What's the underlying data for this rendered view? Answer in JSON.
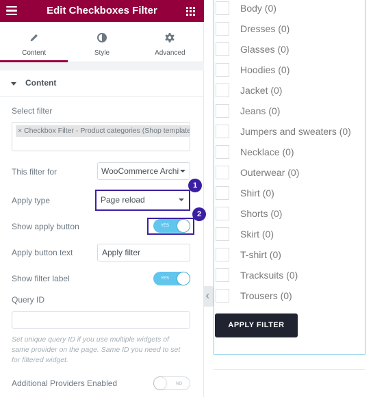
{
  "header": {
    "title": "Edit Checkboxes Filter",
    "menu_icon": "hamburger-icon",
    "grid_icon": "apps-grid-icon",
    "brand_color": "#93003c"
  },
  "tabs": [
    {
      "label": "Content",
      "icon": "pencil-icon",
      "active": true
    },
    {
      "label": "Style",
      "icon": "half-circle-icon",
      "active": false
    },
    {
      "label": "Advanced",
      "icon": "gear-icon",
      "active": false
    }
  ],
  "section": {
    "title": "Content"
  },
  "fields": {
    "select_filter": {
      "label": "Select filter",
      "chip": "× Checkbox Filter - Product categories (Shop template)"
    },
    "filter_for": {
      "label": "This filter for",
      "value": "WooCommerce Archive"
    },
    "apply_type": {
      "label": "Apply type",
      "value": "Page reload",
      "badge": "1"
    },
    "show_apply_button": {
      "label": "Show apply button",
      "state": "YES",
      "badge": "2"
    },
    "apply_button_text": {
      "label": "Apply button text",
      "value": "Apply filter"
    },
    "show_filter_label": {
      "label": "Show filter label",
      "state": "YES"
    },
    "query_id": {
      "label": "Query ID",
      "value": "",
      "description": "Set unique query ID if you use multiple widgets of same provider on the page. Same ID you need to set for filtered widget."
    },
    "additional_providers": {
      "label": "Additional Providers Enabled",
      "state": "NO"
    }
  },
  "highlight_color": "#3b1fa3",
  "toggle_on_color": "#61c6ee",
  "preview": {
    "items": [
      "Body (0)",
      "Dresses (0)",
      "Glasses (0)",
      "Hoodies (0)",
      "Jacket (0)",
      "Jeans (0)",
      "Jumpers and sweaters (0)",
      "Necklace (0)",
      "Outerwear (0)",
      "Shirt (0)",
      "Shorts (0)",
      "Skirt (0)",
      "T-shirt (0)",
      "Tracksuits (0)",
      "Trousers (0)"
    ],
    "apply_button": "APPLY FILTER"
  }
}
